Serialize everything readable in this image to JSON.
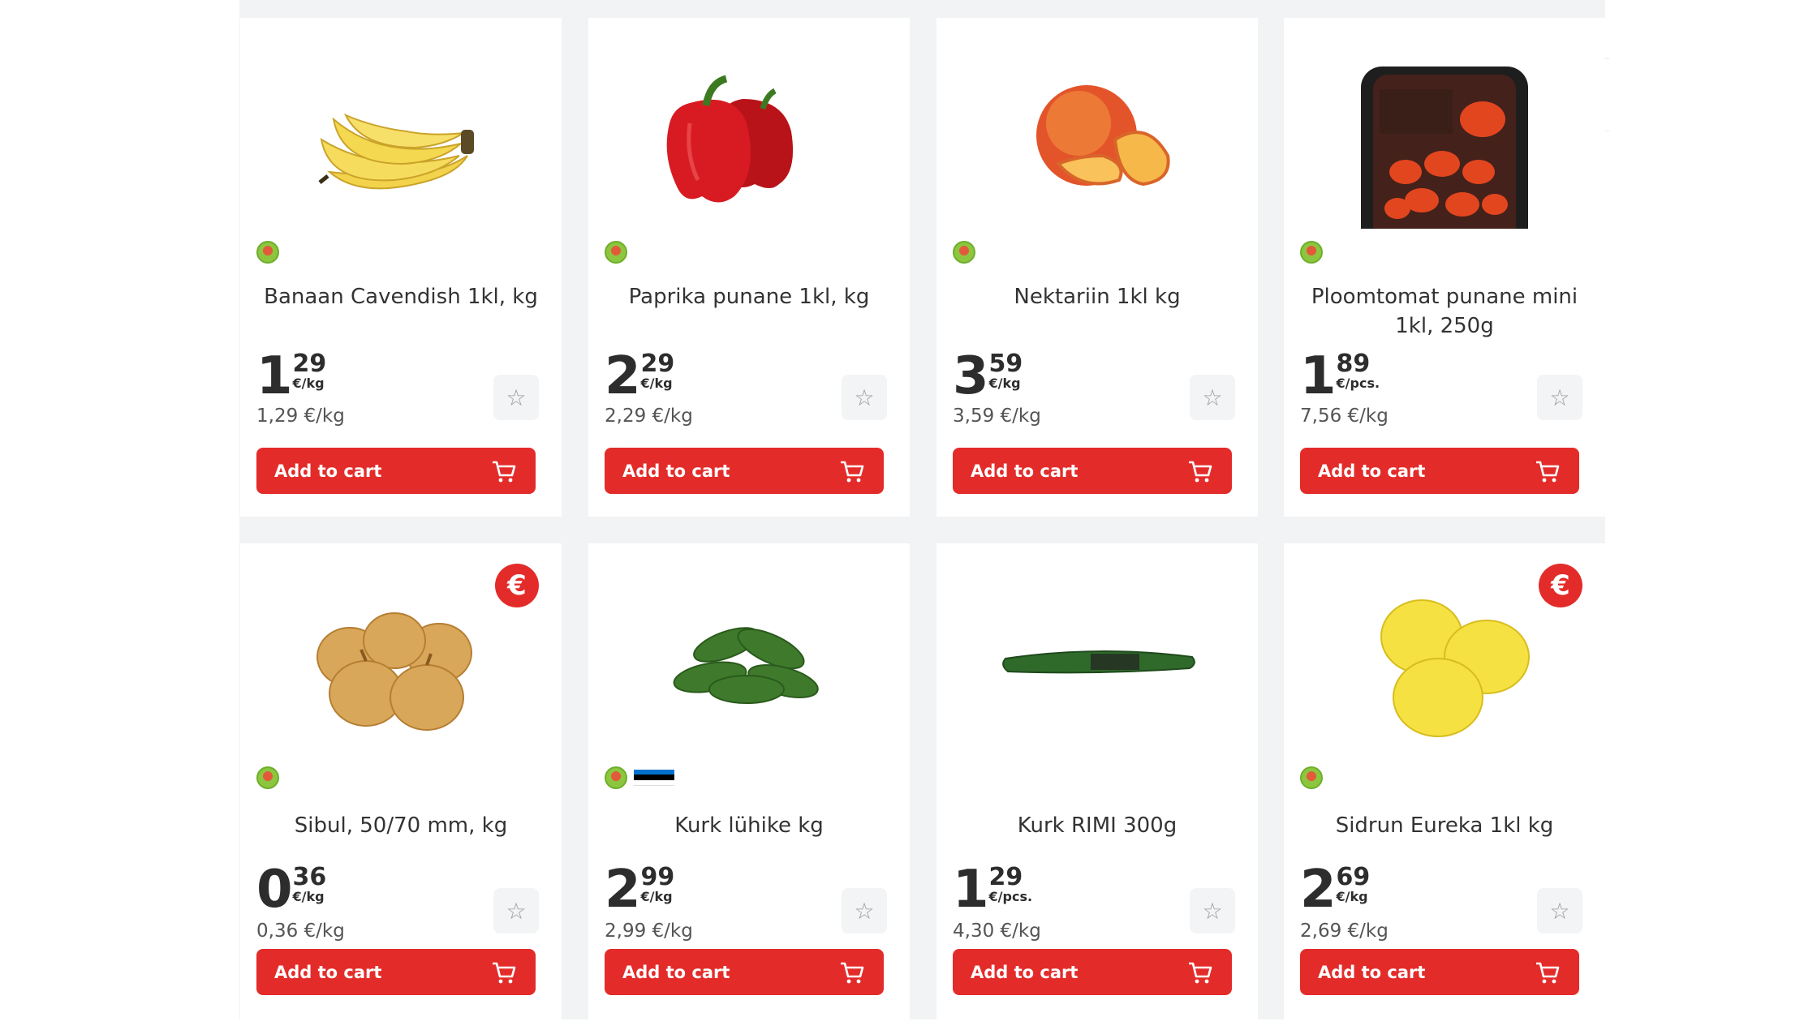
{
  "add_to_cart_label": "Add to cart",
  "colors": {
    "accent": "#e32c2a",
    "background": "#f1f3f4"
  },
  "products": [
    {
      "name": "Banaan Cavendish 1kl, kg",
      "price_euros": "1",
      "price_cents": "29",
      "price_unit": "€/kg",
      "unit_price": "1,29 €/kg",
      "origin_icon": "origin-badge-icon",
      "promo": false
    },
    {
      "name": "Paprika punane 1kl, kg",
      "price_euros": "2",
      "price_cents": "29",
      "price_unit": "€/kg",
      "unit_price": "2,29 €/kg",
      "origin_icon": "origin-badge-icon",
      "promo": false
    },
    {
      "name": "Nektariin 1kl kg",
      "price_euros": "3",
      "price_cents": "59",
      "price_unit": "€/kg",
      "unit_price": "3,59 €/kg",
      "origin_icon": "origin-badge-icon",
      "promo": false
    },
    {
      "name": "Ploomtomat punane mini 1kl, 250g",
      "price_euros": "1",
      "price_cents": "89",
      "price_unit": "€/pcs.",
      "unit_price": "7,56 €/kg",
      "origin_icon": "origin-badge-icon",
      "promo": false
    },
    {
      "name": "Sibul, 50/70 mm, kg",
      "price_euros": "0",
      "price_cents": "36",
      "price_unit": "€/kg",
      "unit_price": "0,36 €/kg",
      "origin_icon": "origin-badge-icon",
      "promo": true
    },
    {
      "name": "Kurk lühike kg",
      "price_euros": "2",
      "price_cents": "99",
      "price_unit": "€/kg",
      "unit_price": "2,99 €/kg",
      "origin_icon": "origin-badge-icon",
      "flag": "estonia-flag-icon",
      "promo": false
    },
    {
      "name": "Kurk RIMI 300g",
      "price_euros": "1",
      "price_cents": "29",
      "price_unit": "€/pcs.",
      "unit_price": "4,30 €/kg",
      "promo": false
    },
    {
      "name": "Sidrun Eureka 1kl kg",
      "price_euros": "2",
      "price_cents": "69",
      "price_unit": "€/kg",
      "unit_price": "2,69 €/kg",
      "origin_icon": "origin-badge-icon",
      "promo": true
    }
  ],
  "icons": {
    "favorite": "star-icon",
    "cart": "cart-icon",
    "promo": "euro-promo-icon"
  }
}
